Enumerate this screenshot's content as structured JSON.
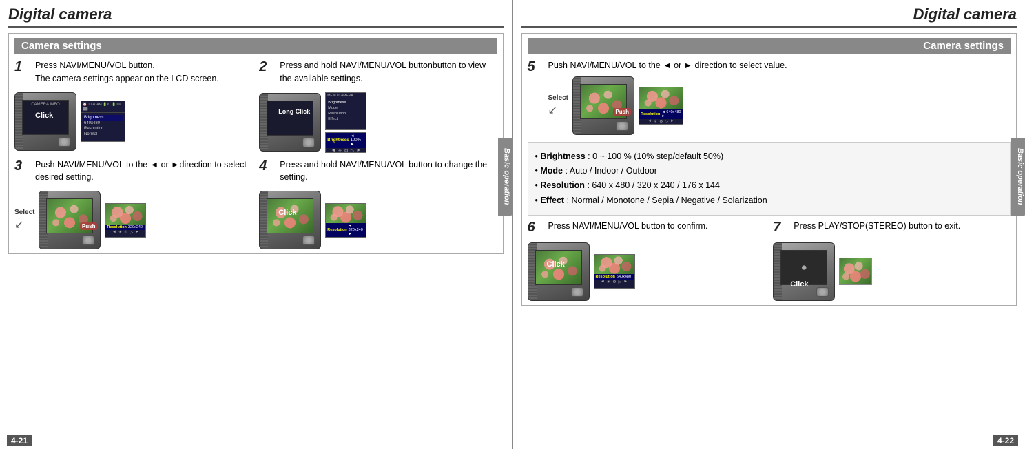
{
  "left_page": {
    "title": "Digital camera",
    "section": "Camera settings",
    "sidebar_label": "Basic operation",
    "page_num": "4-21",
    "steps": [
      {
        "num": "1",
        "text": "Press NAVI/MENU/VOL button.\nThe camera settings appear on the LCD screen.",
        "images": [
          "camera-click",
          "lcd-screen"
        ]
      },
      {
        "num": "2",
        "text": "Press and hold NAVI/MENU/VOL buttonbutton to view the available settings.",
        "images": [
          "camera-long-click",
          "brightness-screen"
        ]
      },
      {
        "num": "3",
        "text": "Push NAVI/MENU/VOL to the ◄ or ►direction to select desired setting.",
        "images": [
          "camera-select-push",
          "resolution-screen"
        ]
      },
      {
        "num": "4",
        "text": "Press and hold NAVI/MENU/VOL button to change the setting.",
        "images": [
          "camera-click2",
          "resolution-screen2"
        ]
      }
    ],
    "click_label": "Click",
    "long_click_label": "Long Click",
    "push_label": "Push",
    "select_label": "Select"
  },
  "right_page": {
    "title": "Digital camera",
    "section": "Camera settings",
    "sidebar_label": "Basic operation",
    "page_num": "4-22",
    "steps": [
      {
        "num": "5",
        "text": "Push NAVI/MENU/VOL to the ◄ or ► direction to select value.",
        "select_label": "Select",
        "push_label": "Push"
      },
      {
        "num": "6",
        "text": "Press NAVI/MENU/VOL button to confirm.",
        "click_label": "Click"
      },
      {
        "num": "7",
        "text": "Press PLAY/STOP(STEREO) button to exit.",
        "click_label": "Click"
      }
    ],
    "bullet_items": [
      {
        "term": "Brightness",
        "desc": ": 0 ~ 100 % (10% step/default 50%)"
      },
      {
        "term": "Mode",
        "desc": ": Auto / Indoor / Outdoor"
      },
      {
        "term": "Resolution",
        "desc": ": 640 x 480 / 320 x 240 / 176 x 144"
      },
      {
        "term": "Effect",
        "desc": ": Normal / Monotone / Sepia / Negative / Solarization"
      }
    ],
    "brightness_label": "Brightness",
    "brightness_val": "◄ 100% ►",
    "resolution_640": "Resolution ◄ 640x480 ►",
    "resolution_320_1": "Resolution 320x240",
    "resolution_320_2": "Resolution ◄ 320x240 ►"
  },
  "icons": {
    "click": "☞",
    "hand": "☞",
    "arrow_left": "◄",
    "arrow_right": "►"
  }
}
